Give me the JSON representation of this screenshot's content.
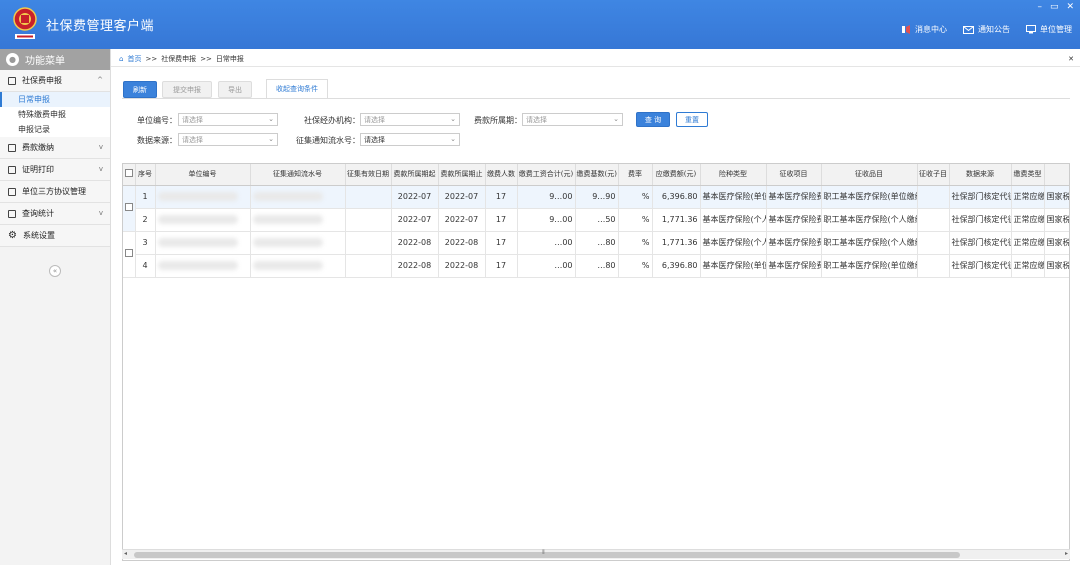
{
  "header": {
    "title": "社保费管理客户端",
    "links": [
      {
        "icon": "message-icon",
        "label": "消息中心"
      },
      {
        "icon": "notice-icon",
        "label": "通知公告"
      },
      {
        "icon": "unit-icon",
        "label": "单位管理"
      }
    ],
    "window_controls": [
      "–",
      "▭",
      "✕"
    ]
  },
  "sidebar": {
    "menu_title": "功能菜单",
    "groups": [
      {
        "label": "社保费申报",
        "chevron": "^",
        "items": [
          "日常申报",
          "特殊缴费申报",
          "申报记录"
        ]
      },
      {
        "label": "费款缴纳",
        "chevron": "v"
      },
      {
        "label": "证明打印",
        "chevron": "v"
      },
      {
        "label": "单位三方协议管理",
        "chevron": ""
      },
      {
        "label": "查询统计",
        "chevron": "v"
      },
      {
        "label": "系统设置",
        "chevron": ""
      }
    ],
    "collapse_label": "«"
  },
  "breadcrumb": {
    "home": "首页",
    "sep": ">>",
    "level1": "社保费申报",
    "level2": "日常申报",
    "close": "✕"
  },
  "toolbar": {
    "refresh": "刷新",
    "submit": "提交申报",
    "export": "导出",
    "filter_tab": "收起查询条件"
  },
  "filters": {
    "unit_no_label": "单位编号：",
    "unit_no_placeholder": "请选择",
    "agency_label": "社保经办机构：",
    "agency_placeholder": "请选择",
    "period_label": "费款所属期：",
    "period_placeholder": "请选择",
    "source_label": "数据来源：",
    "source_placeholder": "请选择",
    "notice_label": "征集通知流水号：",
    "notice_value": "请选择",
    "query": "查 询",
    "reset": "重置"
  },
  "table": {
    "columns": [
      "序号",
      "单位编号",
      "征集通知流水号",
      "征集有效日期",
      "费款所属期起",
      "费款所属期止",
      "缴费人数",
      "缴费工资合计(元)",
      "缴费基数(元)",
      "费率",
      "应缴费额(元)",
      "险种类型",
      "征收项目",
      "征收品目",
      "征收子目",
      "数据来源",
      "缴费类型",
      ""
    ],
    "rows": [
      {
        "no": "1",
        "start": "2022-07",
        "end": "2022-07",
        "count": "17",
        "wage": "9…00",
        "base": "9…90",
        "rate": "%",
        "amount": "6,396.80",
        "insurance": "基本医疗保险(单位)",
        "item": "基本医疗保险费",
        "category": "职工基本医疗保险(单位缴纳)",
        "source": "社保部门核定代征",
        "type": "正常应缴",
        "extra": "国家税务"
      },
      {
        "no": "2",
        "start": "2022-07",
        "end": "2022-07",
        "count": "17",
        "wage": "9…00",
        "base": "…50",
        "rate": "%",
        "amount": "1,771.36",
        "insurance": "基本医疗保险(个人)",
        "item": "基本医疗保险费",
        "category": "职工基本医疗保险(个人缴纳)",
        "source": "社保部门核定代征",
        "type": "正常应缴",
        "extra": "国家税务"
      },
      {
        "no": "3",
        "start": "2022-08",
        "end": "2022-08",
        "count": "17",
        "wage": "…00",
        "base": "…80",
        "rate": "%",
        "amount": "1,771.36",
        "insurance": "基本医疗保险(个人)",
        "item": "基本医疗保险费",
        "category": "职工基本医疗保险(个人缴纳)",
        "source": "社保部门核定代征",
        "type": "正常应缴",
        "extra": "国家税务"
      },
      {
        "no": "4",
        "start": "2022-08",
        "end": "2022-08",
        "count": "17",
        "wage": "…00",
        "base": "…80",
        "rate": "%",
        "amount": "6,396.80",
        "insurance": "基本医疗保险(单位)",
        "item": "基本医疗保险费",
        "category": "职工基本医疗保险(单位缴纳)",
        "source": "社保部门核定代征",
        "type": "正常应缴",
        "extra": "国家税务"
      }
    ]
  },
  "scrollbar": {
    "left": "◂",
    "right": "▸",
    "grip": "⦀"
  }
}
